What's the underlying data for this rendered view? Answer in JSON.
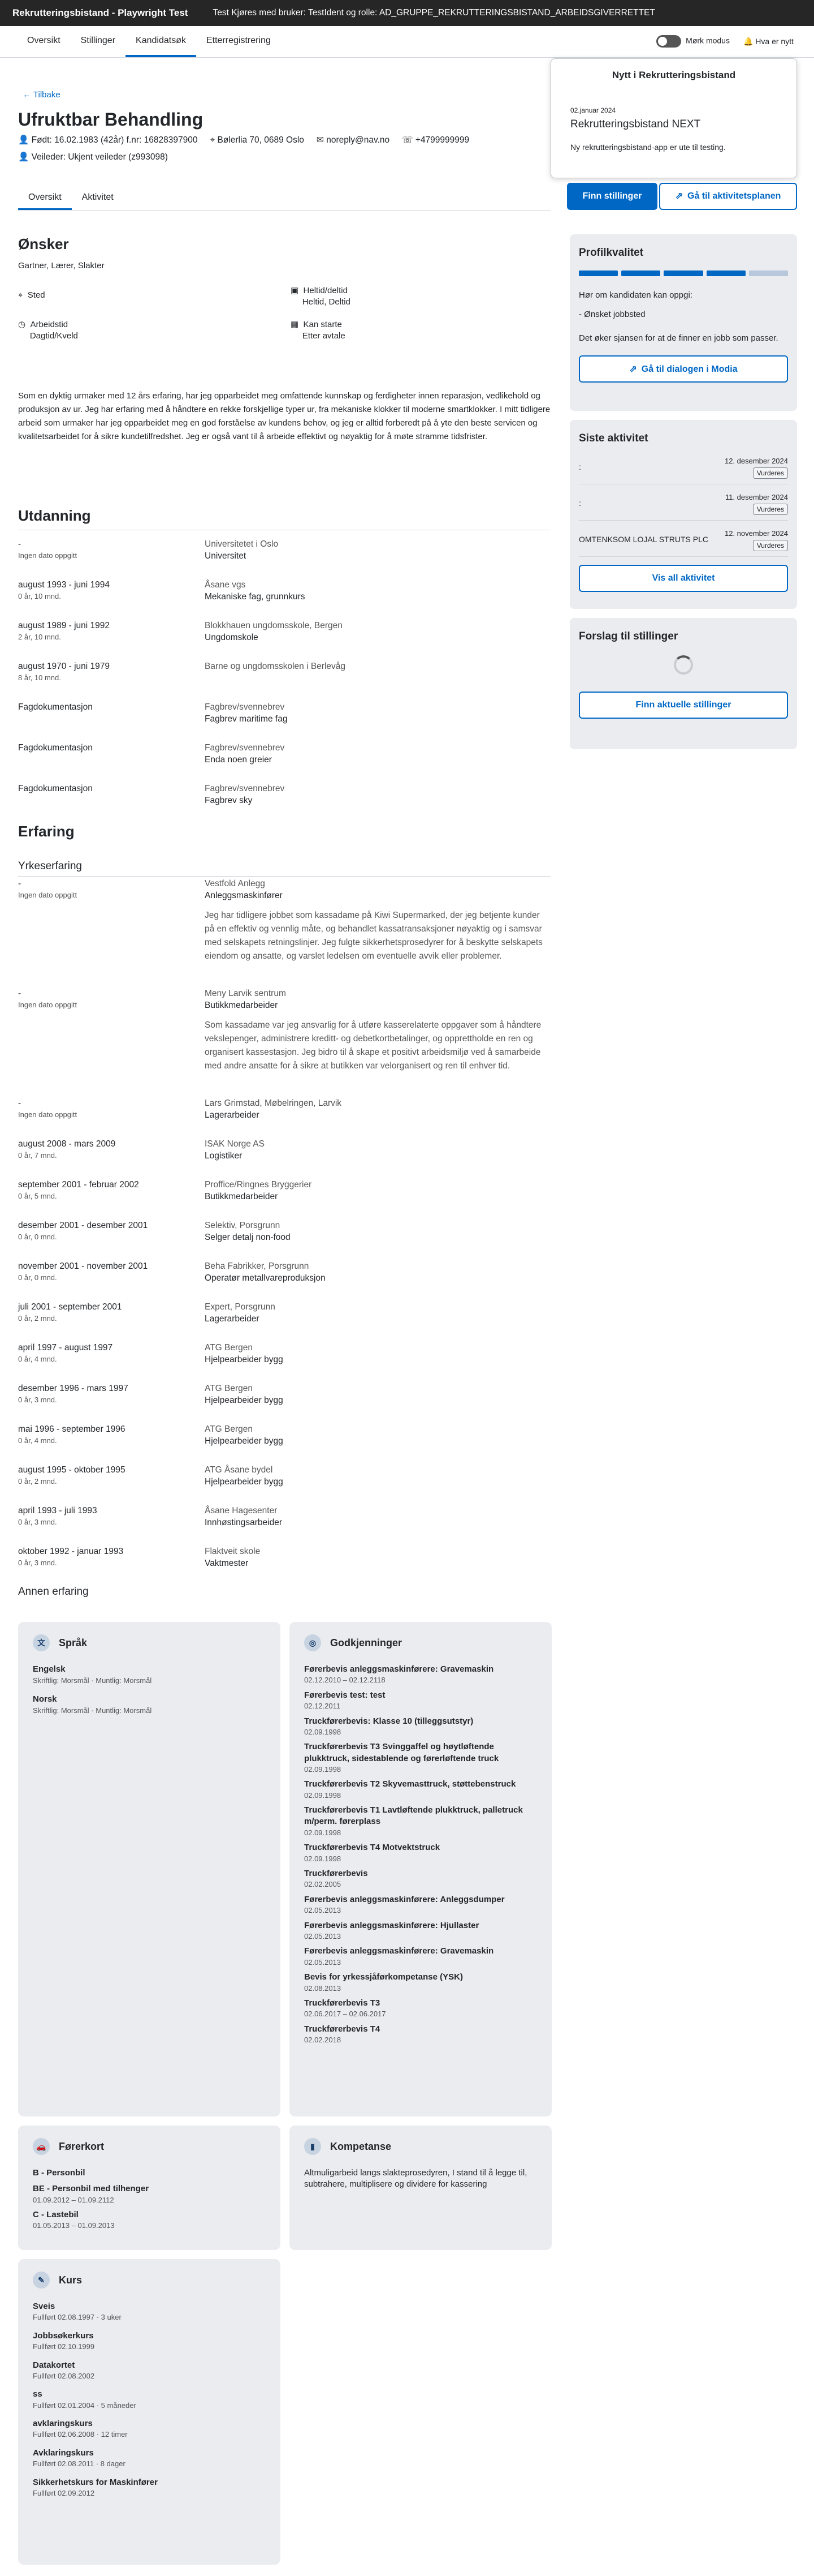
{
  "topbar": {
    "app_title": "Rekrutteringsbistand - Playwright Test",
    "test_info": "Test Kjøres med bruker: TestIdent og rolle: AD_GRUPPE_REKRUTTERINGSBISTAND_ARBEIDSGIVERRETTET"
  },
  "nav": {
    "tabs": [
      "Oversikt",
      "Stillinger",
      "Kandidatsøk",
      "Etterregistrering"
    ],
    "active": "Kandidatsøk",
    "dark_mode": "Mørk modus",
    "help": "Hva er nytt"
  },
  "news": {
    "heading": "Nytt i Rekrutteringsbistand",
    "date": "02.januar 2024",
    "title": "Rekrutteringsbistand NEXT",
    "text": "Ny rekrutteringsbistand-app er ute til testing."
  },
  "candidate": {
    "back": "Tilbake",
    "name": "Ufruktbar Behandling",
    "born": "Født: 16.02.1983 (42år)",
    "fnr": "f.nr: 16828397900",
    "address": "Bølerlia 70, 0689 Oslo",
    "email": "noreply@nav.no",
    "phone": "+4799999999",
    "veileder": "Veileder: Ukjent veileder (z993098)"
  },
  "subtabs": [
    "Oversikt",
    "Aktivitet"
  ],
  "buttons": {
    "finn_stillinger": "Finn stillinger",
    "aktivitetsplan": "Gå til aktivitetsplanen"
  },
  "onsker": {
    "heading": "Ønsker",
    "jobs": "Gartner, Lærer, Slakter",
    "sted_label": "Sted",
    "heltid_label": "Heltid/deltid",
    "heltid_value": "Heltid, Deltid",
    "arbeidstid_label": "Arbeidstid",
    "arbeidstid_value": "Dagtid/Kveld",
    "start_label": "Kan starte",
    "start_value": "Etter avtale"
  },
  "summary": "Som en dyktig urmaker med 12 års erfaring, har jeg opparbeidet meg omfattende kunnskap og ferdigheter innen reparasjon, vedlikehold og produksjon av ur. Jeg har erfaring med å håndtere en rekke forskjellige typer ur, fra mekaniske klokker til moderne smartklokker. I mitt tidligere arbeid som urmaker har jeg opparbeidet meg en god forståelse av kundens behov, og jeg er alltid forberedt på å yte den beste servicen og kvalitetsarbeidet for å sikre kundetilfredshet. Jeg er også vant til å arbeide effektivt og nøyaktig for å møte stramme tidsfrister.",
  "utdanning": {
    "heading": "Utdanning",
    "rows": [
      {
        "d": "-",
        "s": "Ingen dato oppgitt",
        "a": "Universitetet i Oslo",
        "b": "Universitet"
      },
      {
        "d": "august 1993 - juni 1994",
        "s": "0 år, 10 mnd.",
        "a": "Åsane vgs",
        "b": "Mekaniske fag, grunnkurs"
      },
      {
        "d": "august 1989 - juni 1992",
        "s": "2 år, 10 mnd.",
        "a": "Blokkhauen ungdomsskole, Bergen",
        "b": "Ungdomskole"
      },
      {
        "d": "august 1970 - juni 1979",
        "s": "8 år, 10 mnd.",
        "a": "Barne og ungdomsskolen i Berlevåg",
        "b": ""
      },
      {
        "d": "Fagdokumentasjon",
        "s": "",
        "a": "Fagbrev/svennebrev",
        "b": "Fagbrev maritime fag"
      },
      {
        "d": "Fagdokumentasjon",
        "s": "",
        "a": "Fagbrev/svennebrev",
        "b": "Enda noen greier"
      },
      {
        "d": "Fagdokumentasjon",
        "s": "",
        "a": "Fagbrev/svennebrev",
        "b": "Fagbrev sky"
      }
    ]
  },
  "erfaring": {
    "heading": "Erfaring",
    "sub": "Yrkeserfaring",
    "rows": [
      {
        "d": "-",
        "s": "Ingen dato oppgitt",
        "a": "Vestfold Anlegg",
        "b": "Anleggsmaskinfører",
        "t": "Jeg har tidligere jobbet som kassadame på Kiwi Supermarked, der jeg betjente kunder på en effektiv og vennlig måte, og behandlet kassatransaksjoner nøyaktig og i samsvar med selskapets retningslinjer. Jeg fulgte sikkerhetsprosedyrer for å beskytte selskapets eiendom og ansatte, og varslet ledelsen om eventuelle avvik eller problemer."
      },
      {
        "d": "-",
        "s": "Ingen dato oppgitt",
        "a": "Meny Larvik sentrum",
        "b": "Butikkmedarbeider",
        "t": "Som kassadame var jeg ansvarlig for å utføre kasserelaterte oppgaver som å håndtere vekslepenger, administrere kreditt- og debetkortbetalinger, og opprettholde en ren og organisert kassestasjon. Jeg bidro til å skape et positivt arbeidsmiljø ved å samarbeide med andre ansatte for å sikre at butikken var velorganisert og ren til enhver tid."
      },
      {
        "d": "-",
        "s": "Ingen dato oppgitt",
        "a": "Lars Grimstad, Møbelringen, Larvik",
        "b": "Lagerarbeider",
        "t": ""
      },
      {
        "d": "august 2008 - mars 2009",
        "s": "0 år, 7 mnd.",
        "a": "ISAK Norge AS",
        "b": "Logistiker",
        "t": ""
      },
      {
        "d": "september 2001 - februar 2002",
        "s": "0 år, 5 mnd.",
        "a": "Proffice/Ringnes Bryggerier",
        "b": "Butikkmedarbeider",
        "t": ""
      },
      {
        "d": "desember 2001 - desember 2001",
        "s": "0 år, 0 mnd.",
        "a": "Selektiv, Porsgrunn",
        "b": "Selger detalj non-food",
        "t": ""
      },
      {
        "d": "november 2001 - november 2001",
        "s": "0 år, 0 mnd.",
        "a": "Beha Fabrikker, Porsgrunn",
        "b": "Operatør metallvareproduksjon",
        "t": ""
      },
      {
        "d": "juli 2001 - september 2001",
        "s": "0 år, 2 mnd.",
        "a": "Expert, Porsgrunn",
        "b": "Lagerarbeider",
        "t": ""
      },
      {
        "d": "april 1997 - august 1997",
        "s": "0 år, 4 mnd.",
        "a": "ATG Bergen",
        "b": "Hjelpearbeider bygg",
        "t": ""
      },
      {
        "d": "desember 1996 - mars 1997",
        "s": "0 år, 3 mnd.",
        "a": "ATG Bergen",
        "b": "Hjelpearbeider bygg",
        "t": ""
      },
      {
        "d": "mai 1996 - september 1996",
        "s": "0 år, 4 mnd.",
        "a": "ATG Bergen",
        "b": "Hjelpearbeider bygg",
        "t": ""
      },
      {
        "d": "august 1995 - oktober 1995",
        "s": "0 år, 2 mnd.",
        "a": "ATG Åsane bydel",
        "b": "Hjelpearbeider bygg",
        "t": ""
      },
      {
        "d": "april 1993 - juli 1993",
        "s": "0 år, 3 mnd.",
        "a": "Åsane Hagesenter",
        "b": "Innhøstingsarbeider",
        "t": ""
      },
      {
        "d": "oktober 1992 - januar 1993",
        "s": "0 år, 3 mnd.",
        "a": "Flaktveit skole",
        "b": "Vaktmester",
        "t": ""
      }
    ],
    "annen": "Annen erfaring"
  },
  "sprak": {
    "heading": "Språk",
    "items": [
      {
        "n": "Engelsk",
        "s": "Skriftlig: Morsmål",
        "m": "Muntlig: Morsmål"
      },
      {
        "n": "Norsk",
        "s": "Skriftlig: Morsmål",
        "m": "Muntlig: Morsmål"
      }
    ]
  },
  "godkjenninger": {
    "heading": "Godkjenninger",
    "items": [
      {
        "n": "Førerbevis anleggsmaskinførere: Gravemaskin",
        "d": "02.12.2010 – 02.12.2118"
      },
      {
        "n": "Førerbevis test: test",
        "d": "02.12.2011"
      },
      {
        "n": "Truckførerbevis: Klasse 10 (tilleggsutstyr)",
        "d": "02.09.1998"
      },
      {
        "n": "Truckførerbevis T3 Svinggaffel og høytløftende plukktruck, sidestablende og førerløftende truck",
        "d": "02.09.1998"
      },
      {
        "n": "Truckførerbevis T2 Skyvemasttruck, støttebenstruck",
        "d": "02.09.1998"
      },
      {
        "n": "Truckførerbevis T1 Lavtløftende plukktruck, palletruck m/perm. førerplass",
        "d": "02.09.1998"
      },
      {
        "n": "Truckførerbevis T4 Motvektstruck",
        "d": "02.09.1998"
      },
      {
        "n": "Truckførerbevis",
        "d": "02.02.2005"
      },
      {
        "n": "Førerbevis anleggsmaskinførere: Anleggsdumper",
        "d": "02.05.2013"
      },
      {
        "n": "Førerbevis anleggsmaskinførere: Hjullaster",
        "d": "02.05.2013"
      },
      {
        "n": "Førerbevis anleggsmaskinførere: Gravemaskin",
        "d": "02.05.2013"
      },
      {
        "n": "Bevis for yrkessjåførkompetanse (YSK)",
        "d": "02.08.2013"
      },
      {
        "n": "Truckførerbevis T3",
        "d": "02.06.2017 – 02.06.2017"
      },
      {
        "n": "Truckførerbevis T4",
        "d": "02.02.2018"
      }
    ]
  },
  "forerkort": {
    "heading": "Førerkort",
    "items": [
      {
        "n": "B - Personbil",
        "d": ""
      },
      {
        "n": "BE - Personbil med tilhenger",
        "d": "01.09.2012 – 01.09.2112"
      },
      {
        "n": "C - Lastebil",
        "d": "01.05.2013 – 01.09.2013"
      }
    ]
  },
  "kompetanse": {
    "heading": "Kompetanse",
    "text": "Altmuligarbeid langs slakteprosedyren, I stand til å legge til, subtrahere, multiplisere og dividere for kassering"
  },
  "kurs": {
    "heading": "Kurs",
    "items": [
      {
        "n": "Sveis",
        "d": "Fullført 02.08.1997",
        "x": "3 uker"
      },
      {
        "n": "Jobbsøkerkurs",
        "d": "Fullført 02.10.1999",
        "x": ""
      },
      {
        "n": "Datakortet",
        "d": "Fullført 02.08.2002",
        "x": ""
      },
      {
        "n": "ss",
        "d": "Fullført 02.01.2004",
        "x": "5 måneder"
      },
      {
        "n": "avklaringskurs",
        "d": "Fullført 02.06.2008",
        "x": "12 timer"
      },
      {
        "n": "Avklaringskurs",
        "d": "Fullført 02.08.2011",
        "x": "8 dager"
      },
      {
        "n": "Sikkerhetskurs for Maskinfører",
        "d": "Fullført 02.09.2012",
        "x": ""
      }
    ]
  },
  "profil": {
    "heading": "Profilkvalitet",
    "q": "Hør om kandidaten kan oppgi:",
    "item": "- Ønsket jobbsted",
    "text": "Det øker sjansen for at de finner en jobb som passer.",
    "button": "Gå til dialogen i Modia"
  },
  "siste": {
    "heading": "Siste aktivitet",
    "items": [
      {
        "t": ":",
        "d": "12. desember 2024",
        "b": "Vurderes"
      },
      {
        "t": ":",
        "d": "11. desember 2024",
        "b": "Vurderes"
      },
      {
        "t": "OMTENKSOM LOJAL STRUTS PLC",
        "d": "12. november 2024",
        "b": "Vurderes"
      }
    ],
    "button": "Vis all aktivitet"
  },
  "forslag": {
    "heading": "Forslag til stillinger",
    "button": "Finn aktuelle stillinger"
  }
}
